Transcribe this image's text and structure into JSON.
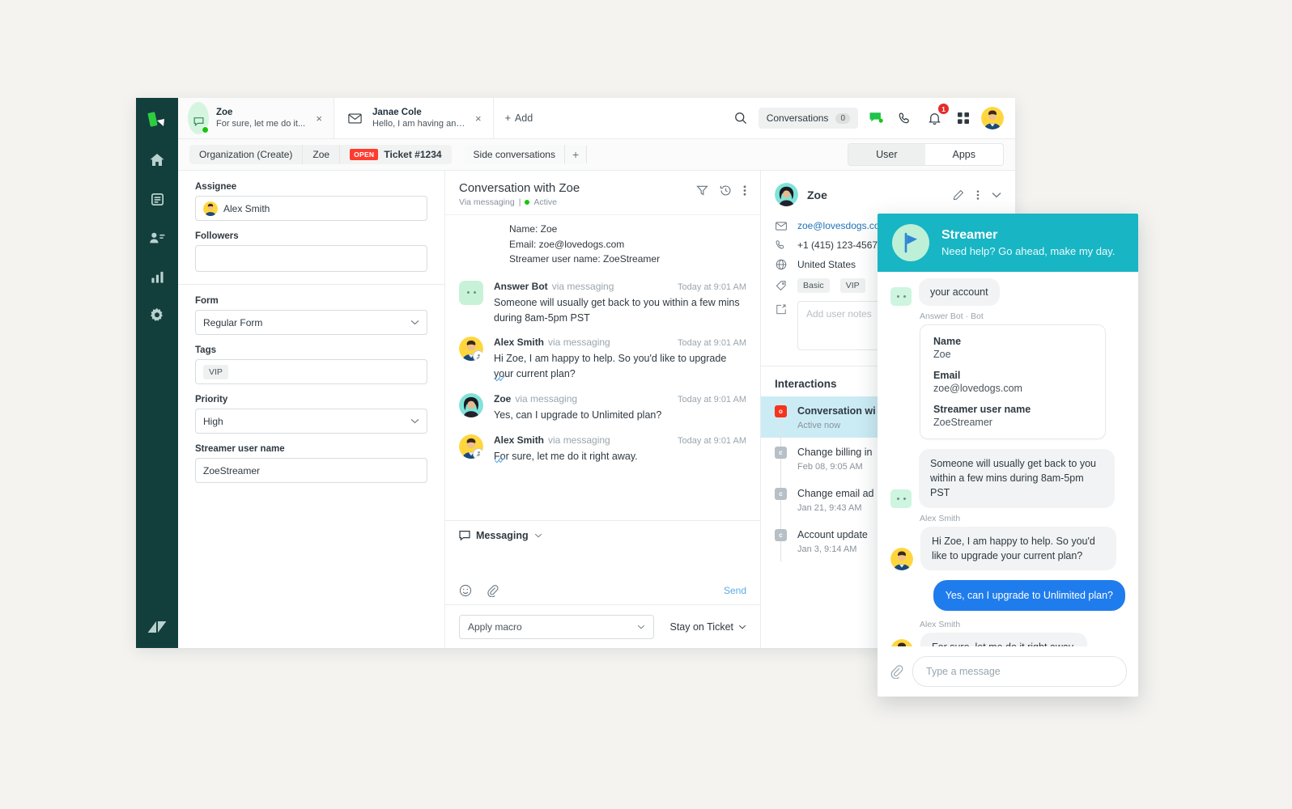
{
  "rail": {
    "logo": "zendesk-products-logo",
    "items": [
      {
        "name": "home-icon",
        "label": "Home"
      },
      {
        "name": "views-icon",
        "label": "Views"
      },
      {
        "name": "customers-icon",
        "label": "Customers"
      },
      {
        "name": "reporting-icon",
        "label": "Reporting"
      },
      {
        "name": "settings-icon",
        "label": "Settings"
      }
    ],
    "footer_logo": "zendesk-logo"
  },
  "topbar": {
    "tabs": [
      {
        "title": "Zoe",
        "subtitle": "For sure, let me do it...",
        "icon": "chat-bubble-icon",
        "active": true,
        "online": true
      },
      {
        "title": "Janae Cole",
        "subtitle": "Hello, I am having an is...",
        "icon": "envelope-icon",
        "active": false,
        "online": false
      }
    ],
    "add_label": "Add",
    "search_icon": "search-icon",
    "conversations_label": "Conversations",
    "conversations_count": "0",
    "talk_icon": "phone-icon",
    "chat_icon": "chat-status-icon",
    "bell_icon": "bell-icon",
    "notification_count": "1",
    "apps_grid_icon": "grid-icon",
    "profile_avatar": "user-avatar"
  },
  "breadcrumb": {
    "items": [
      {
        "label": "Organization (Create)"
      },
      {
        "label": "Zoe"
      },
      {
        "label": "Ticket #1234",
        "badge": "OPEN"
      }
    ],
    "side_conversations_label": "Side conversations",
    "side_conversations_add": "+",
    "segments": [
      {
        "label": "User",
        "selected": true
      },
      {
        "label": "Apps",
        "selected": false
      }
    ]
  },
  "form": {
    "assignee": {
      "label": "Assignee",
      "value": "Alex Smith"
    },
    "followers": {
      "label": "Followers",
      "value": ""
    },
    "form_field": {
      "label": "Form",
      "value": "Regular Form"
    },
    "tags": {
      "label": "Tags",
      "values": [
        "VIP"
      ]
    },
    "priority": {
      "label": "Priority",
      "value": "High"
    },
    "streamer_user_name": {
      "label": "Streamer user name",
      "value": "ZoeStreamer"
    }
  },
  "conversation": {
    "title": "Conversation with Zoe",
    "via": "Via messaging",
    "status": "Active",
    "icons": [
      "filter-icon",
      "history-icon",
      "more-options-icon"
    ],
    "system_lines": [
      "Name: Zoe",
      "Email: zoe@lovedogs.com",
      "Streamer user name: ZoeStreamer"
    ],
    "messages": [
      {
        "author": "Answer Bot",
        "via": "via messaging",
        "time": "Today at 9:01 AM",
        "text": "Someone will usually get back to you within a few mins during 8am-5pm PST",
        "avatar": "bot-avatar",
        "receipt": false
      },
      {
        "author": "Alex Smith",
        "via": "via messaging",
        "time": "Today at 9:01 AM",
        "text": "Hi Zoe, I am happy to help. So you'd like to upgrade your current plan?",
        "avatar": "agent-avatar",
        "receipt": true
      },
      {
        "author": "Zoe",
        "via": "via messaging",
        "time": "Today at 9:01 AM",
        "text": "Yes, can I upgrade to Unlimited plan?",
        "avatar": "customer-avatar",
        "receipt": false
      },
      {
        "author": "Alex Smith",
        "via": "via messaging",
        "time": "Today at 9:01 AM",
        "text": "For sure, let me do it right away.",
        "avatar": "agent-avatar",
        "receipt": true
      }
    ],
    "composer": {
      "channel": "Messaging",
      "emoji_icon": "emoji-icon",
      "attach_icon": "attachment-icon",
      "send_label": "Send"
    },
    "footer": {
      "macro_placeholder": "Apply macro",
      "submit_label": "Stay on Ticket"
    }
  },
  "user_panel": {
    "name": "Zoe",
    "icons": [
      "edit-icon",
      "more-options-icon",
      "collapse-icon"
    ],
    "email": "zoe@lovesdogs.co",
    "phone": "+1 (415) 123-4567",
    "country": "United States",
    "tags": [
      "Basic",
      "VIP"
    ],
    "notes_placeholder": "Add user notes",
    "interactions_title": "Interactions",
    "interactions": [
      {
        "title": "Conversation wi",
        "subtitle": "Active now",
        "badge": "o",
        "selected": true
      },
      {
        "title": "Change billing in",
        "subtitle": "Feb 08, 9:05 AM",
        "badge": "c",
        "selected": false
      },
      {
        "title": "Change email ad",
        "subtitle": "Jan 21, 9:43 AM",
        "badge": "c",
        "selected": false
      },
      {
        "title": "Account update",
        "subtitle": "Jan 3, 9:14 AM",
        "badge": "c",
        "selected": false
      }
    ]
  },
  "widget": {
    "brand_color": "#18b5c4",
    "title": "Streamer",
    "tagline": "Need help? Go ahead, make my day.",
    "logo_icon": "streamer-flag-icon",
    "partial_bubble": "your account",
    "bot_label": "Answer Bot · Bot",
    "card": [
      {
        "key": "Name",
        "value": "Zoe"
      },
      {
        "key": "Email",
        "value": "zoe@lovedogs.com"
      },
      {
        "key": "Streamer user name",
        "value": "ZoeStreamer"
      }
    ],
    "messages": [
      {
        "type": "bot",
        "text": "Someone will usually get back to you within a few mins during 8am-5pm PST"
      },
      {
        "type": "agent",
        "label": "Alex Smith",
        "text": "Hi Zoe, I am happy to help. So you'd like to upgrade your current plan?"
      },
      {
        "type": "me",
        "text": "Yes, can I upgrade to Unlimited plan?"
      },
      {
        "type": "agent",
        "label": "Alex Smith",
        "text": "For sure, let me do it right away."
      }
    ],
    "composer": {
      "attach_icon": "paperclip-icon",
      "placeholder": "Type a message"
    }
  }
}
